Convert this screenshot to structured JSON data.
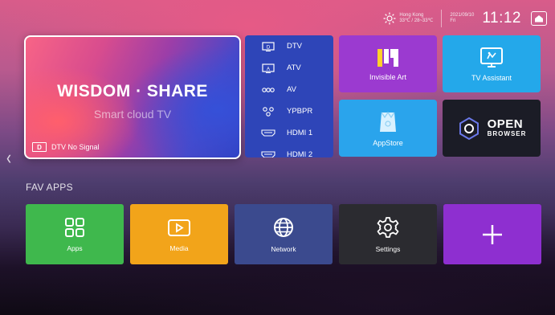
{
  "topbar": {
    "weather_city": "Hong Kong",
    "weather_temp": "33℃ / 28~33℃",
    "date": "2021/09/10",
    "weekday": "Fri",
    "time": "11:12"
  },
  "hero": {
    "title": "WISDOM · SHARE",
    "subtitle": "Smart cloud TV",
    "status_icon_text": "D",
    "status": "DTV No Signal"
  },
  "sources": [
    {
      "label": "DTV",
      "icon": "dtv-icon"
    },
    {
      "label": "ATV",
      "icon": "atv-icon"
    },
    {
      "label": "AV",
      "icon": "av-icon"
    },
    {
      "label": "YPBPR",
      "icon": "ypbpr-icon"
    },
    {
      "label": "HDMI 1",
      "icon": "hdmi-icon"
    },
    {
      "label": "HDMI 2",
      "icon": "hdmi-icon"
    }
  ],
  "tiles": {
    "invisible_art": "Invisible Art",
    "tv_assistant": "TV Assistant",
    "app_store": "AppStore",
    "browser_line1": "OPEN",
    "browser_line2": "BROWSER"
  },
  "fav": {
    "title": "FAV APPS",
    "items": [
      {
        "label": "Apps",
        "color": "#3fb84d"
      },
      {
        "label": "Media",
        "color": "#f2a41a"
      },
      {
        "label": "Network",
        "color": "#3b4a8e"
      },
      {
        "label": "Settings",
        "color": "#2b2b30"
      },
      {
        "label": "",
        "color": "#8e2fd0"
      }
    ]
  }
}
